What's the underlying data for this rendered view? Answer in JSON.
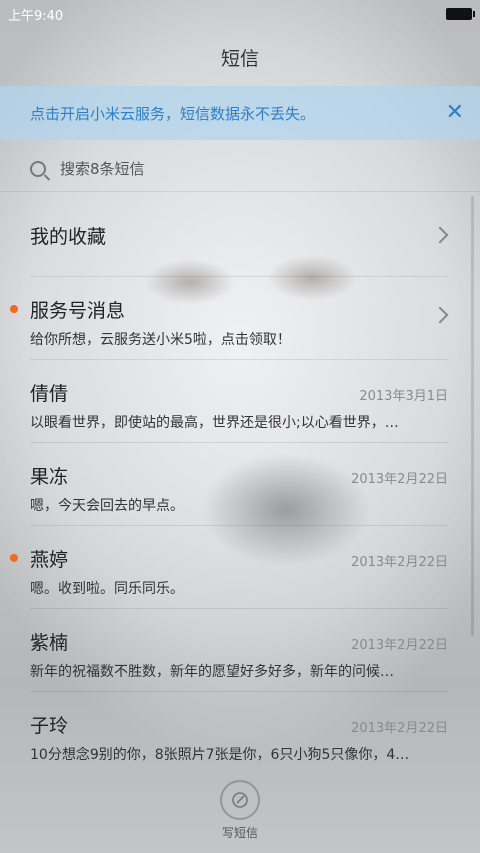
{
  "status_bar": {
    "time": "上午9:40"
  },
  "header": {
    "title": "短信"
  },
  "banner": {
    "text": "点击开启小米云服务，短信数据永不丢失。",
    "close_label": "✕"
  },
  "search": {
    "placeholder": "搜索8条短信"
  },
  "conversations": [
    {
      "name": "我的收藏",
      "preview": "",
      "date": "",
      "unread": false,
      "chevron": true
    },
    {
      "name": "服务号消息",
      "preview": "给你所想，云服务送小米5啦，点击领取！",
      "date": "",
      "unread": true,
      "chevron": true
    },
    {
      "name": "倩倩",
      "preview": "以眼看世界，即使站的最高，世界还是很小;以心看世界，…",
      "date": "2013年3月1日",
      "unread": false,
      "chevron": false
    },
    {
      "name": "果冻",
      "preview": "嗯，今天会回去的早点。",
      "date": "2013年2月22日",
      "unread": false,
      "chevron": false
    },
    {
      "name": "燕婷",
      "preview": "嗯。收到啦。同乐同乐。",
      "date": "2013年2月22日",
      "unread": true,
      "chevron": false
    },
    {
      "name": "紫楠",
      "preview": "新年的祝福数不胜数，新年的愿望好多好多，新年的问候…",
      "date": "2013年2月22日",
      "unread": false,
      "chevron": false
    },
    {
      "name": "子玲",
      "preview": "10分想念9别的你，8张照片7张是你，6只小狗5只像你，4…",
      "date": "2013年2月22日",
      "unread": false,
      "chevron": false
    }
  ],
  "compose": {
    "label": "写短信",
    "icon": "pencil-icon"
  },
  "colors": {
    "accent": "#2f7fc4",
    "unread_dot": "#f26a1e"
  }
}
